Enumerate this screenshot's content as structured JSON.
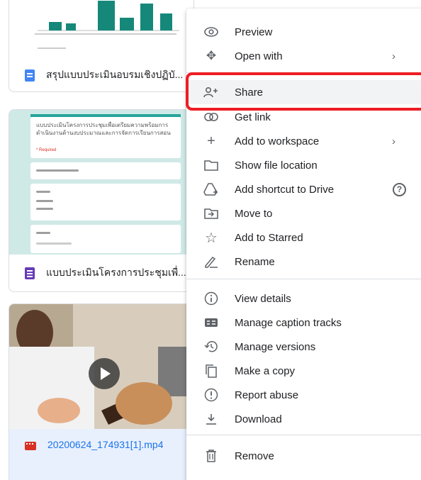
{
  "files": [
    {
      "title": "สรุปแบบประเมินอบรมเชิงปฏิบั...",
      "icon": "google-docs-icon"
    },
    {
      "title": "แบบประเมินโครงการประชุมเพื่...",
      "icon": "google-forms-icon"
    },
    {
      "title": "20200624_174931[1].mp4",
      "icon": "video-file-icon"
    }
  ],
  "form_preview": {
    "heading": "แบบประเมินโครงการประชุมเพื่อเตรียมความพร้อมการดำเนินงานด้านงบประมาณและการจัดการเรียนการสอน",
    "required_note": "* Required"
  },
  "context_menu": {
    "items": [
      {
        "label": "Preview",
        "icon": "eye-icon"
      },
      {
        "label": "Open with",
        "icon": "move-arrows-icon",
        "submenu": true
      },
      {
        "label": "Share",
        "icon": "add-person-icon",
        "highlighted": true
      },
      {
        "label": "Get link",
        "icon": "link-icon"
      },
      {
        "label": "Add to workspace",
        "icon": "plus-icon",
        "submenu": true
      },
      {
        "label": "Show file location",
        "icon": "folder-icon"
      },
      {
        "label": "Add shortcut to Drive",
        "icon": "add-shortcut-icon",
        "help": true
      },
      {
        "label": "Move to",
        "icon": "move-to-folder-icon"
      },
      {
        "label": "Add to Starred",
        "icon": "star-icon"
      },
      {
        "label": "Rename",
        "icon": "pencil-icon"
      },
      {
        "label": "View details",
        "icon": "info-icon"
      },
      {
        "label": "Manage caption tracks",
        "icon": "closed-caption-icon"
      },
      {
        "label": "Manage versions",
        "icon": "history-icon"
      },
      {
        "label": "Make a copy",
        "icon": "copy-icon"
      },
      {
        "label": "Report abuse",
        "icon": "report-icon"
      },
      {
        "label": "Download",
        "icon": "download-icon"
      },
      {
        "label": "Remove",
        "icon": "trash-icon"
      }
    ]
  },
  "colors": {
    "highlight_outline": "#ee1d23",
    "teal": "#26a69a",
    "chart_bar": "#15887a"
  }
}
